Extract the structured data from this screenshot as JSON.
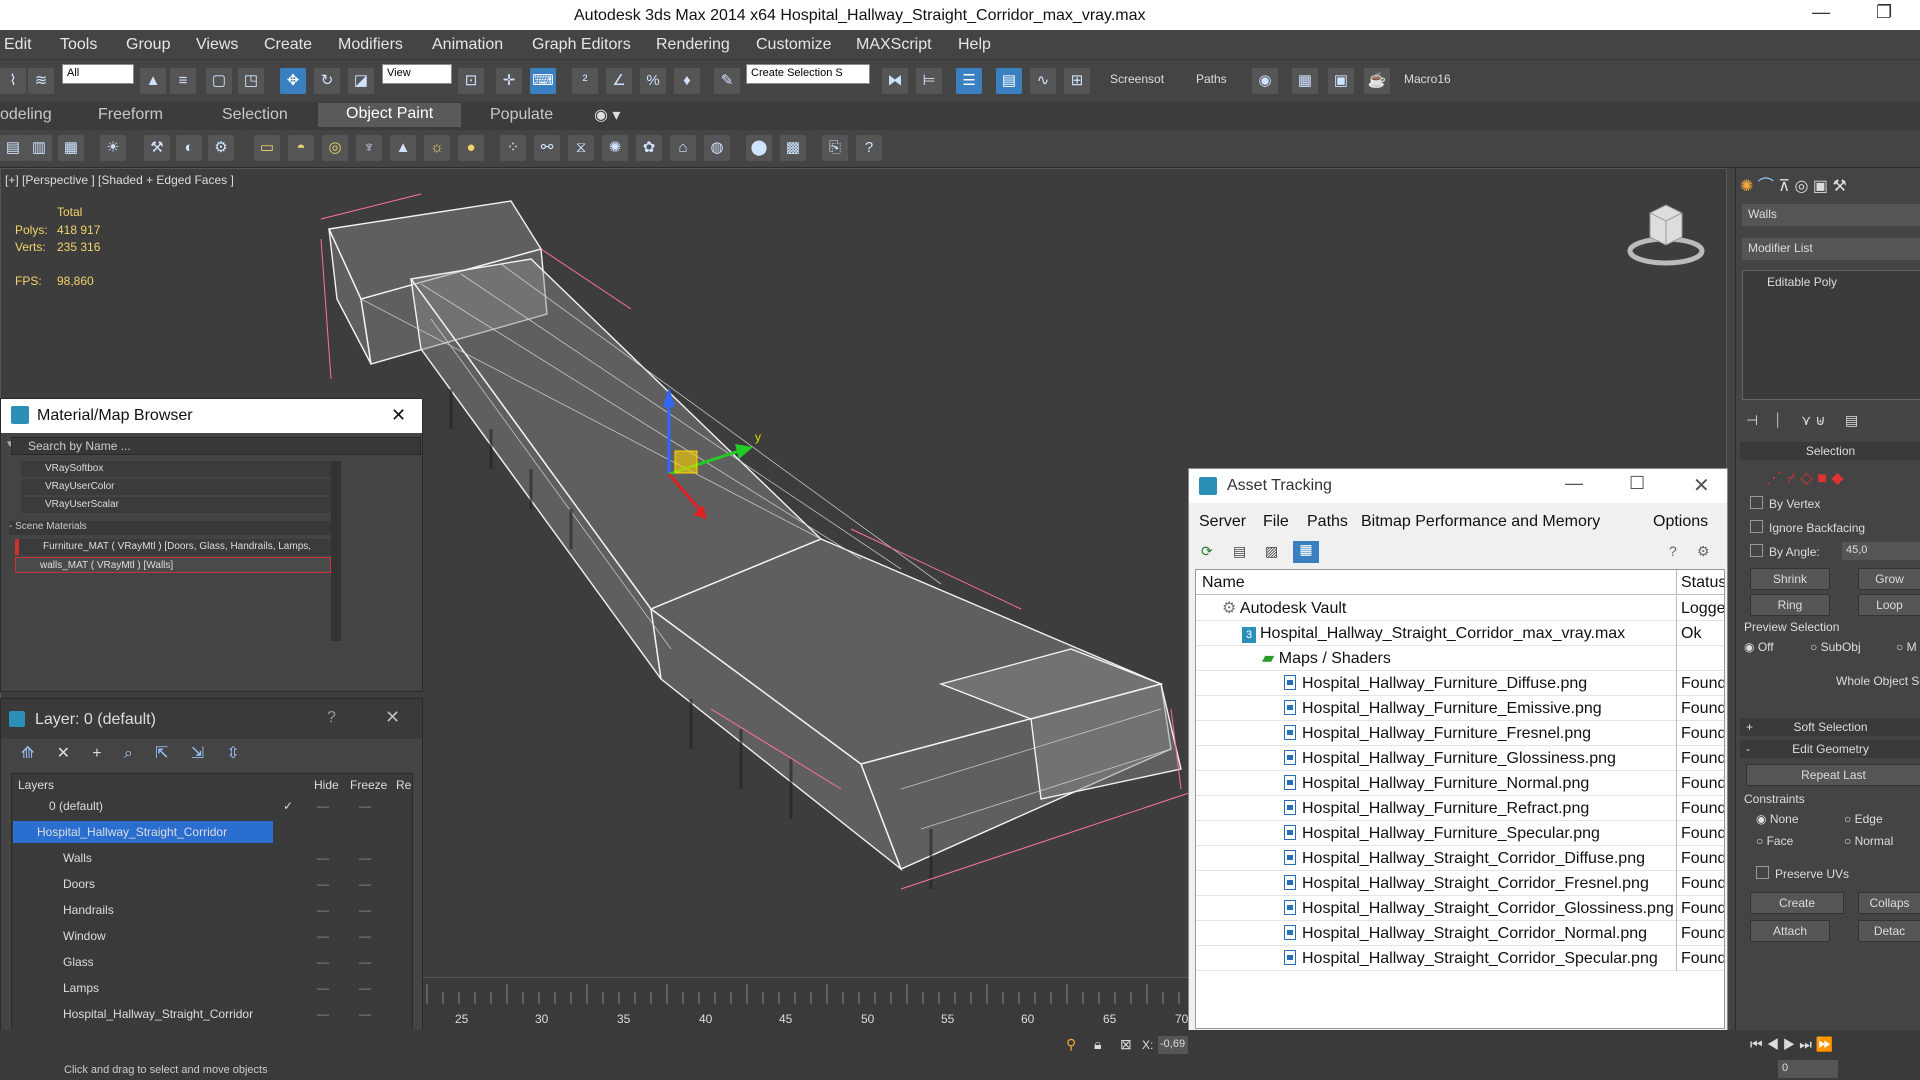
{
  "window": {
    "title": "Autodesk 3ds Max  2014 x64     Hospital_Hallway_Straight_Corridor_max_vray.max",
    "minimize": "—",
    "restore": "❐"
  },
  "menu": [
    "Edit",
    "Tools",
    "Group",
    "Views",
    "Create",
    "Modifiers",
    "Animation",
    "Graph Editors",
    "Rendering",
    "Customize",
    "MAXScript",
    "Help"
  ],
  "toolbar": {
    "filter_select": "All",
    "view_select": "View",
    "selection_set": "Create Selection S",
    "labels": [
      "Screensot",
      "Paths",
      "Macro16"
    ]
  },
  "ribbon_tabs": [
    "odeling",
    "Freeform",
    "Selection",
    "Object Paint",
    "Populate"
  ],
  "viewport": {
    "label": "[+] [Perspective ] [Shaded + Edged Faces ]",
    "stats_header": "Total",
    "polys_label": "Polys:",
    "polys": "418 917",
    "verts_label": "Verts:",
    "verts": "235 316",
    "fps_label": "FPS:",
    "fps": "98,860",
    "axis_y": "y"
  },
  "material_browser": {
    "title": "Material/Map Browser",
    "search_placeholder": "Search by Name ...",
    "items": [
      "VRaySoftbox",
      "VRayUserColor",
      "VRayUserScalar"
    ],
    "scene_header": "- Scene Materials",
    "scene_items": [
      "Furniture_MAT ( VRayMtl ) [Doors, Glass, Handrails, Lamps, Wi...",
      "walls_MAT ( VRayMtl ) [Walls]"
    ]
  },
  "layer_panel": {
    "title": "Layer: 0 (default)",
    "help": "?",
    "col_layers": "Layers",
    "col_hide": "Hide",
    "col_freeze": "Freeze",
    "col_render": "Re",
    "rows": [
      "0 (default)",
      "Hospital_Hallway_Straight_Corridor",
      "Walls",
      "Doors",
      "Handrails",
      "Window",
      "Glass",
      "Lamps",
      "Hospital_Hallway_Straight_Corridor"
    ]
  },
  "asset_tracking": {
    "title": "Asset Tracking",
    "menu": [
      "Server",
      "File",
      "Paths",
      "Bitmap Performance and Memory",
      "Options"
    ],
    "col_name": "Name",
    "col_status": "Status",
    "rows": [
      {
        "name": "Autodesk Vault",
        "status": "Logged",
        "indent": 1
      },
      {
        "name": "Hospital_Hallway_Straight_Corridor_max_vray.max",
        "status": "Ok",
        "indent": 2
      },
      {
        "name": "Maps / Shaders",
        "status": "",
        "indent": 3
      },
      {
        "name": "Hospital_Hallway_Furniture_Diffuse.png",
        "status": "Found",
        "indent": 4
      },
      {
        "name": "Hospital_Hallway_Furniture_Emissive.png",
        "status": "Found",
        "indent": 4
      },
      {
        "name": "Hospital_Hallway_Furniture_Fresnel.png",
        "status": "Found",
        "indent": 4
      },
      {
        "name": "Hospital_Hallway_Furniture_Glossiness.png",
        "status": "Found",
        "indent": 4
      },
      {
        "name": "Hospital_Hallway_Furniture_Normal.png",
        "status": "Found",
        "indent": 4
      },
      {
        "name": "Hospital_Hallway_Furniture_Refract.png",
        "status": "Found",
        "indent": 4
      },
      {
        "name": "Hospital_Hallway_Furniture_Specular.png",
        "status": "Found",
        "indent": 4
      },
      {
        "name": "Hospital_Hallway_Straight_Corridor_Diffuse.png",
        "status": "Found",
        "indent": 4
      },
      {
        "name": "Hospital_Hallway_Straight_Corridor_Fresnel.png",
        "status": "Found",
        "indent": 4
      },
      {
        "name": "Hospital_Hallway_Straight_Corridor_Glossiness.png",
        "status": "Found",
        "indent": 4
      },
      {
        "name": "Hospital_Hallway_Straight_Corridor_Normal.png",
        "status": "Found",
        "indent": 4
      },
      {
        "name": "Hospital_Hallway_Straight_Corridor_Specular.png",
        "status": "Found",
        "indent": 4
      }
    ]
  },
  "command_panel": {
    "object_name": "Walls",
    "modifier_list": "Modifier List",
    "stack_item": "Editable Poly",
    "selection": "Selection",
    "by_vertex": "By Vertex",
    "ignore_backfacing": "Ignore Backfacing",
    "by_angle": "By Angle:",
    "angle_value": "45,0",
    "shrink": "Shrink",
    "grow": "Grow",
    "ring": "Ring",
    "loop": "Loop",
    "preview_selection": "Preview Selection",
    "off": "Off",
    "subobj": "SubObj",
    "multi": "M",
    "whole_object": "Whole Object Se",
    "soft_selection": "Soft Selection",
    "edit_geometry": "Edit Geometry",
    "repeat_last": "Repeat Last",
    "constraints": "Constraints",
    "none": "None",
    "edge": "Edge",
    "face": "Face",
    "normal": "Normal",
    "preserve_uvs": "Preserve UVs",
    "create": "Create",
    "collapse": "Collaps",
    "attach": "Attach",
    "detach": "Detac",
    "plus": "+",
    "minus": "-"
  },
  "timeline": {
    "ticks": [
      "25",
      "30",
      "35",
      "40",
      "45",
      "50",
      "55",
      "60",
      "65",
      "70"
    ],
    "coord_label": "X:",
    "coord_value": "-0,69"
  },
  "status": {
    "hint": "Click and drag to select and move objects",
    "frame": "0"
  }
}
